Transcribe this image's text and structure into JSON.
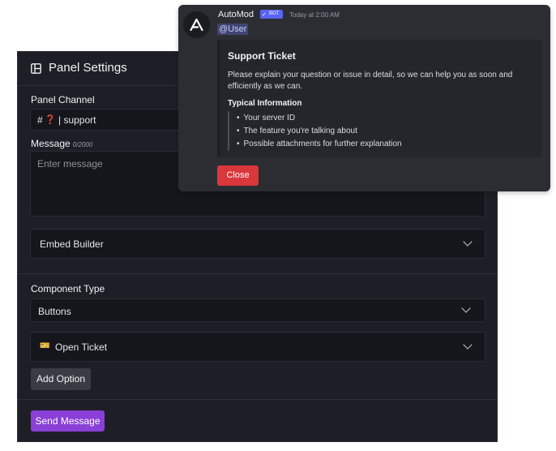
{
  "panel": {
    "title": "Panel Settings",
    "channel_label": "Panel Channel",
    "channel_hash": "#",
    "channel_emoji": "❓",
    "channel_name": "| support",
    "message_label": "Message",
    "message_count": "0/2000",
    "message_placeholder": "Enter message",
    "embed_builder_label": "Embed Builder",
    "component_type_label": "Component Type",
    "component_type_value": "Buttons",
    "option_emoji": "🎫",
    "option_label": "Open Ticket",
    "add_option_label": "Add Option",
    "send_label": "Send Message"
  },
  "preview": {
    "bot_name": "AutoMod",
    "bot_badge": "BOT",
    "timestamp": "Today at 2:00 AM",
    "mention": "@User",
    "embed": {
      "title": "Support Ticket",
      "description": "Please explain your question or issue in detail, so we can help you as soon and efficiently as we can.",
      "field_name": "Typical Information",
      "items": [
        "Your server ID",
        "The feature you're talking about",
        "Possible attachments for further explanation"
      ]
    },
    "close_label": "Close"
  },
  "colors": {
    "accent_purple": "#8a3fd6",
    "danger_red": "#da373c",
    "bot_badge_blue": "#5865f2",
    "panel_bg": "#1e1f26"
  },
  "icons": [
    "panel-icon",
    "chevron-down-icon",
    "ticket-icon",
    "question-icon",
    "automod-logo",
    "check-icon"
  ]
}
